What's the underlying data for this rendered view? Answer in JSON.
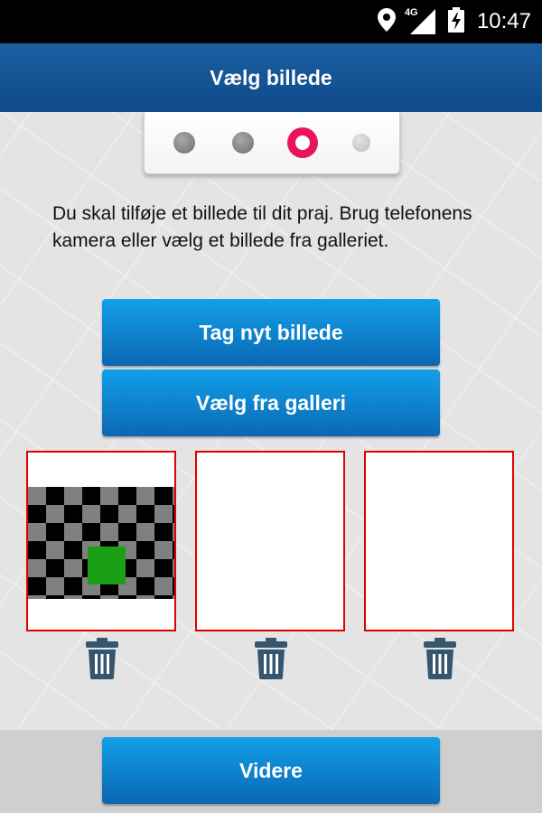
{
  "status": {
    "network": "4G",
    "time": "10:47"
  },
  "appbar": {
    "title": "Vælg billede"
  },
  "stepper": {
    "total_steps": 4,
    "current_step": 3,
    "active_color": "#e9155a"
  },
  "instruction": "Du skal tilføje et billede til dit praj. Brug telefonens kamera eller vælg et billede fra galleriet.",
  "buttons": {
    "take_photo": "Tag nyt billede",
    "choose_gallery": "Vælg fra galleri",
    "next": "Videre"
  },
  "photo_slots": [
    {
      "filled": true,
      "delete_icon": "trash-icon"
    },
    {
      "filled": false,
      "delete_icon": "trash-icon"
    },
    {
      "filled": false,
      "delete_icon": "trash-icon"
    }
  ],
  "colors": {
    "appbar": "#0f4a8a",
    "button": "#0b67b4",
    "slot_border": "#e00000",
    "trash": "#34566f"
  }
}
